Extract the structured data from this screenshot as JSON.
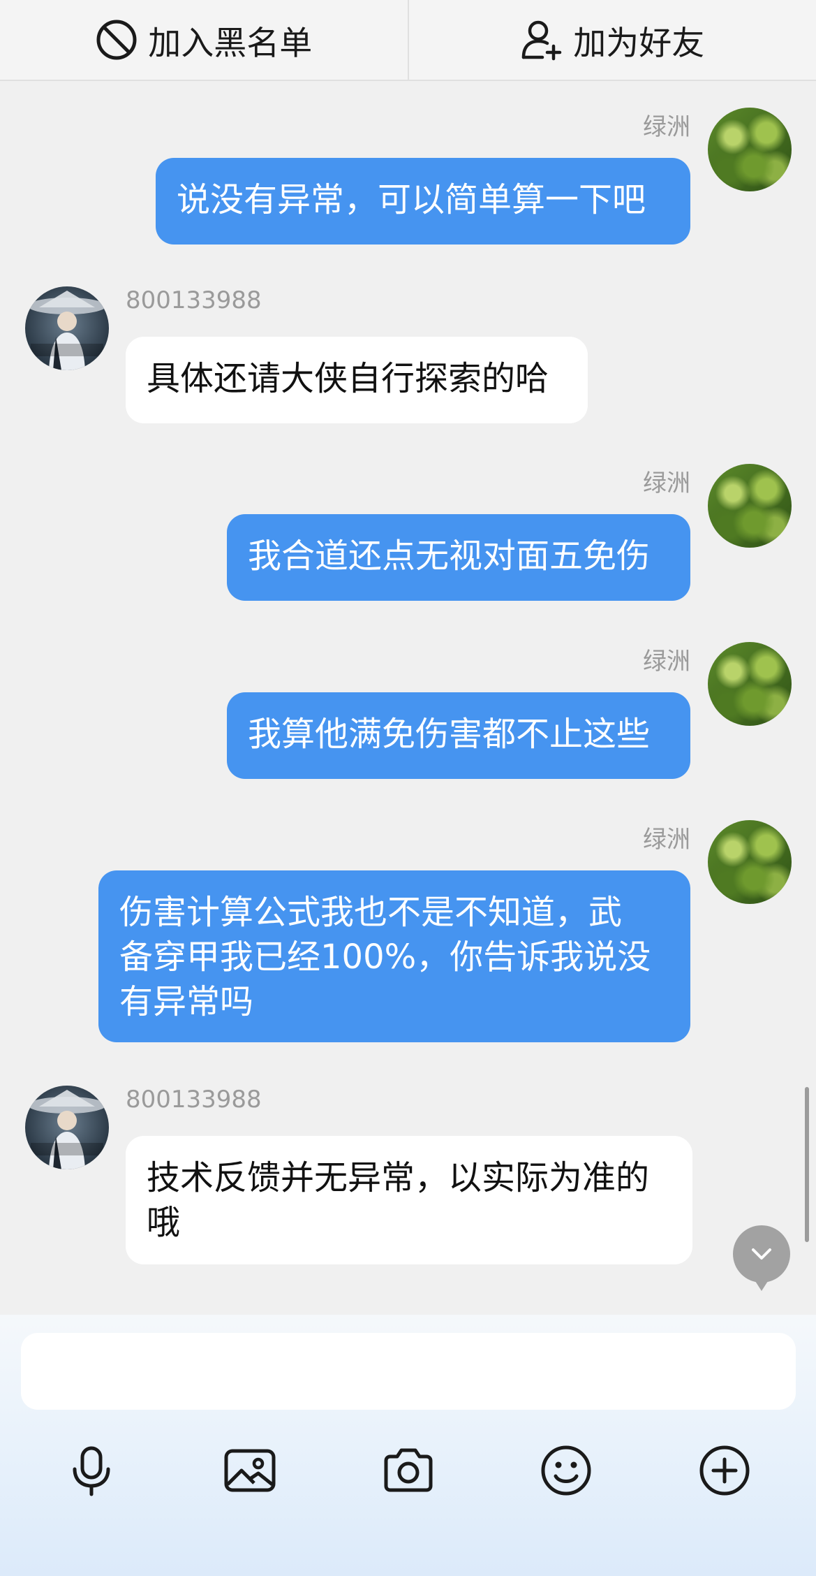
{
  "top_bar": {
    "blacklist_label": "加入黑名单",
    "add_friend_label": "加为好友"
  },
  "messages": [
    {
      "side": "right",
      "sender": "绿洲",
      "text": "说没有异常，可以简单算一下吧"
    },
    {
      "side": "left",
      "sender": "800133988",
      "text": "具体还请大侠自行探索的哈"
    },
    {
      "side": "right",
      "sender": "绿洲",
      "text": "我合道还点无视对面五免伤"
    },
    {
      "side": "right",
      "sender": "绿洲",
      "text": "我算他满免伤害都不止这些"
    },
    {
      "side": "right",
      "sender": "绿洲",
      "text_lines": [
        "伤害计算公式我也不是不知道，武",
        "备穿甲我已经100%，你告诉我说没",
        "有异常吗"
      ]
    },
    {
      "side": "left",
      "sender": "800133988",
      "text_lines": [
        "技术反馈并无异常，以实际为准的",
        "哦"
      ]
    }
  ],
  "composer": {
    "input_value": "",
    "tools": [
      "microphone-icon",
      "image-icon",
      "camera-icon",
      "emoji-icon",
      "plus-icon"
    ]
  },
  "colors": {
    "outgoing_bubble": "#4694f0",
    "incoming_bubble": "#ffffff",
    "background": "#f0f0f0"
  }
}
